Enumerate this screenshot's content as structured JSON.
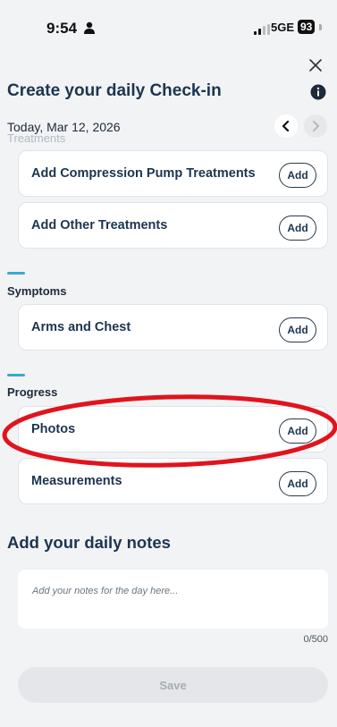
{
  "status_bar": {
    "time": "9:54",
    "network": "5GE",
    "battery": "93"
  },
  "header": {
    "title": "Create your daily Check-in",
    "date": "Today, Mar 12, 2026",
    "faded_section": "Treatments"
  },
  "treatments": [
    {
      "label": "Add Compression Pump Treatments",
      "button": "Add"
    },
    {
      "label": "Add Other Treatments",
      "button": "Add"
    }
  ],
  "symptoms": {
    "label": "Symptoms",
    "items": [
      {
        "label": "Arms and Chest",
        "button": "Add"
      }
    ]
  },
  "progress": {
    "label": "Progress",
    "items": [
      {
        "label": "Photos",
        "button": "Add"
      },
      {
        "label": "Measurements",
        "button": "Add"
      }
    ]
  },
  "notes": {
    "title": "Add your daily notes",
    "placeholder": "Add your notes for the day here...",
    "counter": "0/500"
  },
  "save_label": "Save",
  "colors": {
    "accent": "#3aa8d0",
    "annotation": "#e0141c",
    "heading": "#1c3550"
  }
}
